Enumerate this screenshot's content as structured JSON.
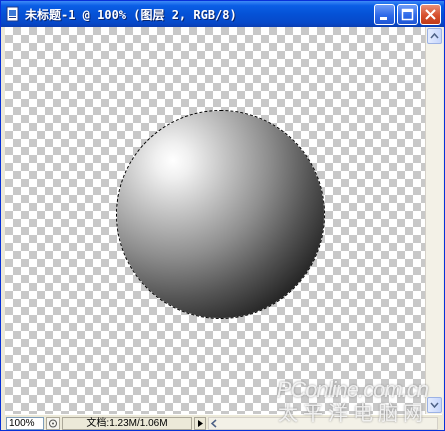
{
  "window": {
    "title": "未标题-1 @ 100% (图层 2, RGB/8)",
    "buttons": [
      "minimize",
      "maximize",
      "close"
    ]
  },
  "canvas": {
    "background": "transparency-checkerboard",
    "object": "gradient-sphere",
    "selection": "elliptical-marquee"
  },
  "statusbar": {
    "zoom": "100%",
    "doc_info": "文档:1.23M/1.06M"
  },
  "watermark": {
    "line1": "PConline.com.cn",
    "line2": "太平洋电脑网"
  },
  "colors": {
    "titlebar": "#0552d6",
    "chrome": "#ece9d8",
    "close_button": "#d6502e"
  }
}
